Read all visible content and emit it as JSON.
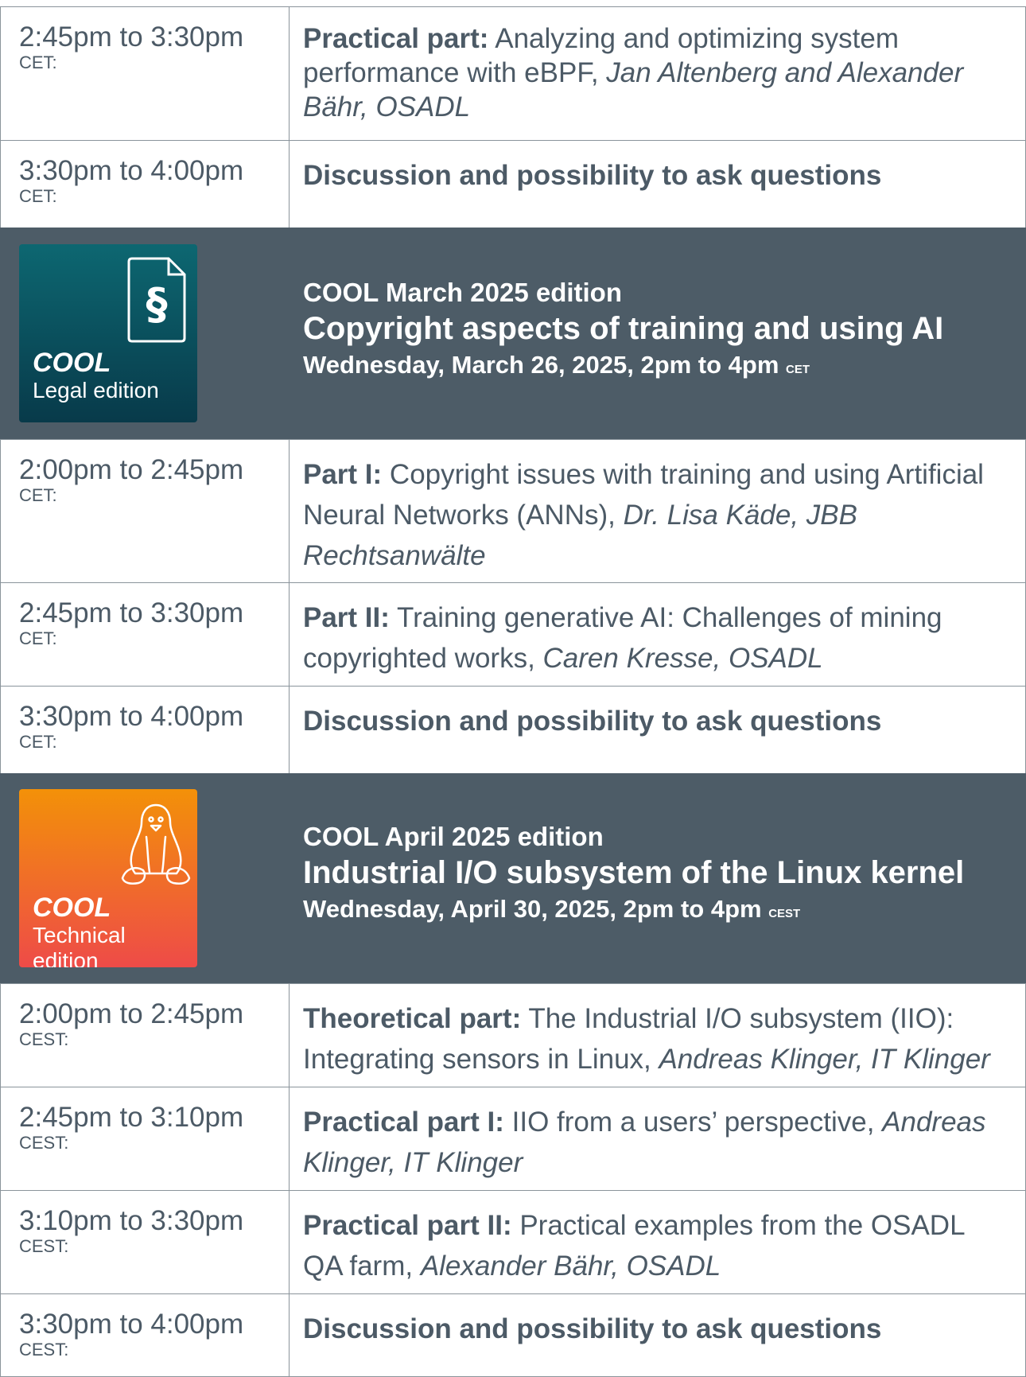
{
  "rows": [
    {
      "time": "2:45pm to 3:30pm",
      "tz": "CET:",
      "label": "Practical part:",
      "text": " Analyzing and optimizing system performance with eBPF, ",
      "speaker": "Jan Altenberg and Alexander Bähr, OSADL"
    },
    {
      "time": "3:30pm to 4:00pm",
      "tz": "CET:",
      "label": "Discussion and possibility to ask questions",
      "text": "",
      "speaker": ""
    },
    {
      "time": "2:00pm to 2:45pm",
      "tz": "CET:",
      "label": "Part I:",
      "text": " Copyright issues with training and using Artificial Neural Networks (ANNs), ",
      "speaker": "Dr. Lisa Käde, JBB Rechtsanwälte"
    },
    {
      "time": "2:45pm to 3:30pm",
      "tz": "CET:",
      "label": "Part II:",
      "text": " Training generative AI: Challenges of mining copyrighted works, ",
      "speaker": "Caren Kresse, OSADL"
    },
    {
      "time": "3:30pm to 4:00pm",
      "tz": "CET:",
      "label": "Discussion and possibility to ask questions",
      "text": "",
      "speaker": ""
    },
    {
      "time": "2:00pm to 2:45pm",
      "tz": "CEST:",
      "label": "Theoretical part:",
      "text": " The Industrial I/O subsystem (IIO): Integrating sensors in Linux, ",
      "speaker": "Andreas Klinger, IT Klinger"
    },
    {
      "time": "2:45pm to 3:10pm",
      "tz": "CEST:",
      "label": "Practical part I:",
      "text": " IIO from a users’ perspective, ",
      "speaker": "Andreas Klinger, IT Klinger"
    },
    {
      "time": "3:10pm to 3:30pm",
      "tz": "CEST:",
      "label": "Practical part II:",
      "text": " Practical examples from the OSADL QA farm, ",
      "speaker": "Alexander Bähr, OSADL"
    },
    {
      "time": "3:30pm to 4:00pm",
      "tz": "CEST:",
      "label": "Discussion and possibility to ask questions",
      "text": "",
      "speaker": ""
    }
  ],
  "headers": [
    {
      "badge_title": "COOL",
      "badge_sub": "Legal edition",
      "badge_icon": "paragraph-document-icon",
      "edition": "COOL March 2025 edition",
      "title": "Copyright aspects of training and using AI",
      "date": "Wednesday, March 26, 2025, 2pm to 4pm",
      "tz": "CET"
    },
    {
      "badge_title": "COOL",
      "badge_sub": "Technical edition",
      "badge_icon": "penguin-icon",
      "edition": "COOL April 2025 edition",
      "title": "Industrial I/O subsystem of the Linux kernel",
      "date": "Wednesday, April 30, 2025, 2pm to 4pm",
      "tz": "CEST"
    }
  ],
  "colors": {
    "header_bg": "#4d5c67",
    "text": "#4c5a66",
    "legal_badge": "#0d6771",
    "tech_badge_top": "#f39108",
    "tech_badge_bottom": "#ee4b48"
  }
}
